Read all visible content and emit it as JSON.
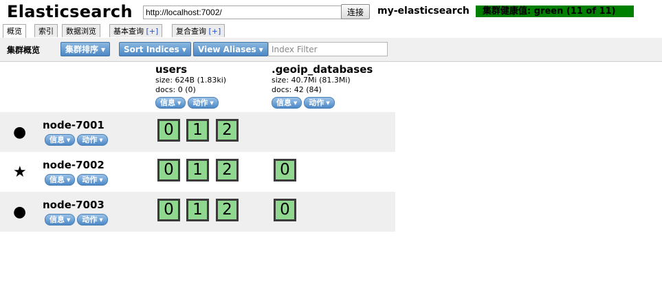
{
  "header": {
    "title": "Elasticsearch",
    "url_value": "http://localhost:7002/",
    "connect_label": "连接",
    "cluster_name": "my-elasticsearch",
    "health": "集群健康值: green (11 of 11)"
  },
  "tabs": [
    {
      "label": "概览",
      "plus": ""
    },
    {
      "label": "索引",
      "plus": ""
    },
    {
      "label": "数据浏览",
      "plus": ""
    },
    {
      "label": "基本查询",
      "plus": "[+]"
    },
    {
      "label": "复合查询",
      "plus": "[+]"
    }
  ],
  "toolbar": {
    "label": "集群概览",
    "sort_cluster": "集群排序",
    "sort_indices": "Sort Indices",
    "view_aliases": "View Aliases",
    "index_filter_placeholder": "Index Filter"
  },
  "indices": [
    {
      "name": "users",
      "size": "size: 624B (1.83ki)",
      "docs": "docs: 0 (0)",
      "info": "信息",
      "action": "动作"
    },
    {
      "name": ".geoip_databases",
      "size": "size: 40.7Mi (81.3Mi)",
      "docs": "docs: 42 (84)",
      "info": "信息",
      "action": "动作"
    }
  ],
  "nodes": [
    {
      "name": "node-7001",
      "icon": "●",
      "icon_name": "circle-icon",
      "info": "信息",
      "action": "动作",
      "users_shards": [
        "0",
        "1",
        "2"
      ],
      "geoip_shards": []
    },
    {
      "name": "node-7002",
      "icon": "★",
      "icon_name": "star-icon",
      "info": "信息",
      "action": "动作",
      "users_shards": [
        "0",
        "1",
        "2"
      ],
      "geoip_shards": [
        "0"
      ]
    },
    {
      "name": "node-7003",
      "icon": "●",
      "icon_name": "circle-icon",
      "info": "信息",
      "action": "动作",
      "users_shards": [
        "0",
        "1",
        "2"
      ],
      "geoip_shards": [
        "0"
      ]
    }
  ],
  "colors": {
    "health_green": "#008000",
    "shard_green": "#90d890",
    "button_blue": "#4c87c4"
  }
}
